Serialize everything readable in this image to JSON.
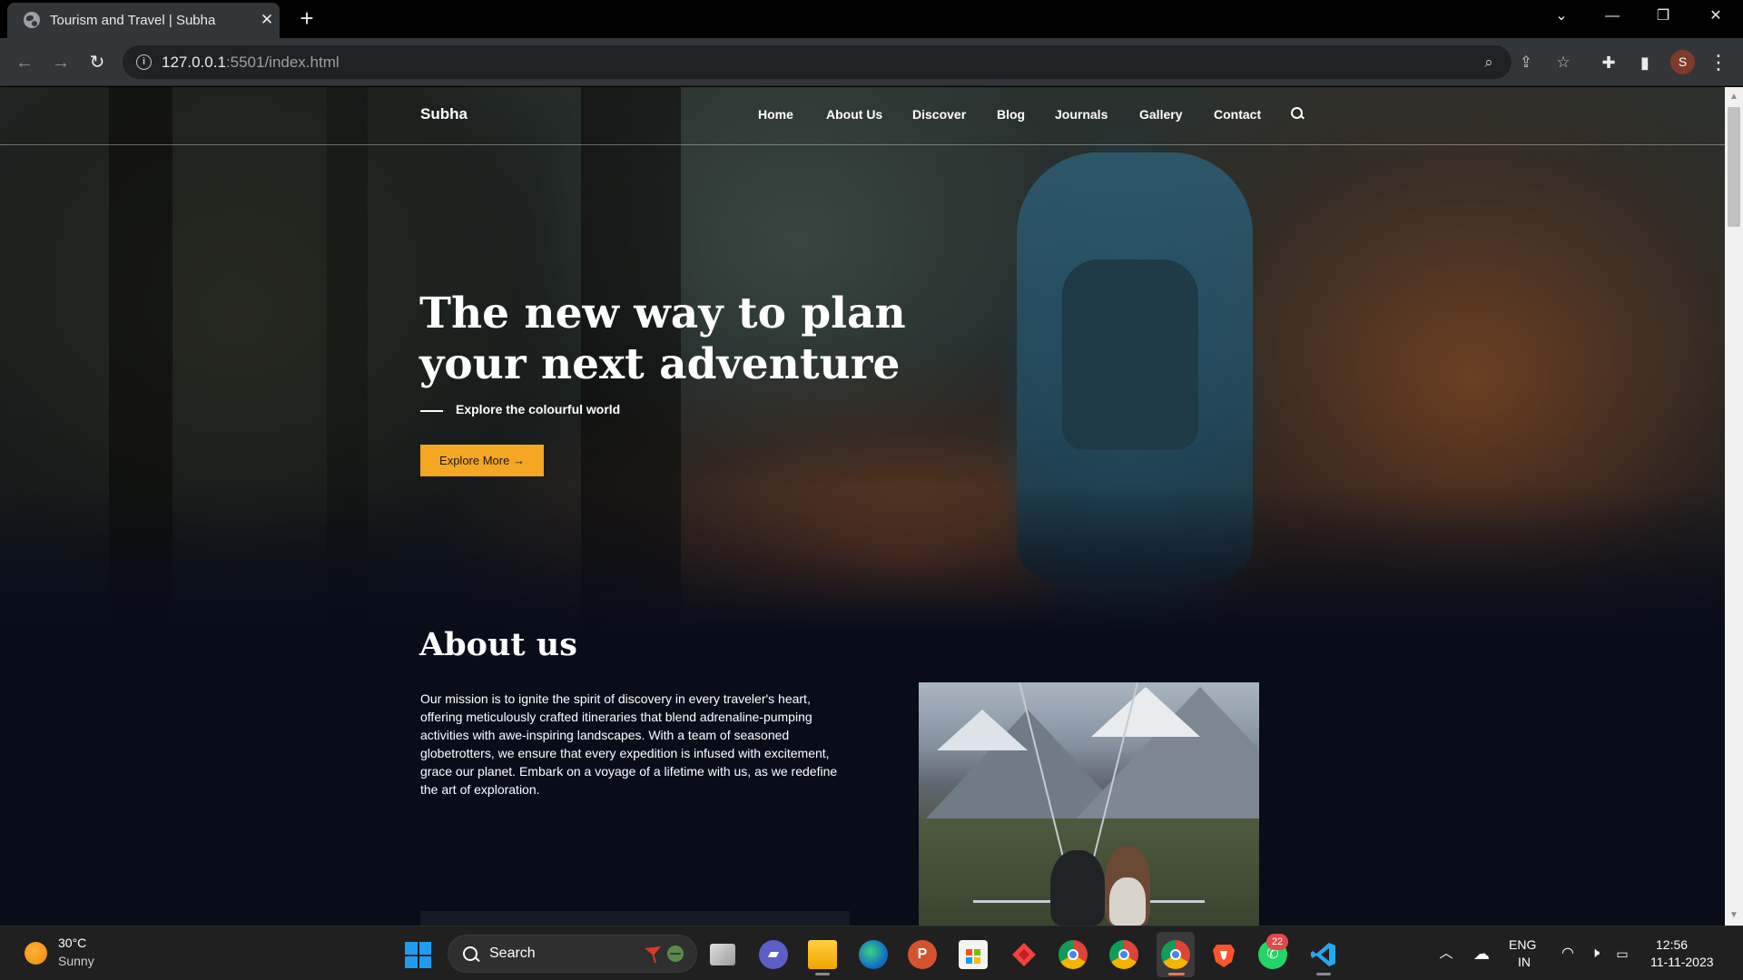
{
  "browser": {
    "tab_title": "Tourism and Travel | Subha",
    "new_tab_label": "+",
    "url_host": "127.0.0.1",
    "url_rest": ":5501/index.html",
    "avatar_letter": "S"
  },
  "site": {
    "brand": "Subha",
    "nav": [
      "Home",
      "About Us",
      "Discover",
      "Blog",
      "Journals",
      "Gallery",
      "Contact"
    ],
    "hero": {
      "title_line1": "The new way to plan",
      "title_line2": "your next adventure",
      "subtitle": "Explore the colourful world",
      "button": "Explore More →"
    },
    "about": {
      "heading": "About us",
      "text": "Our mission is to ignite the spirit of discovery in every traveler's heart, offering meticulously crafted itineraries that blend adrenaline-pumping activities with awe-inspiring landscapes. With a team of seasoned globetrotters, we ensure that every expedition is infused with excitement, grace our planet. Embark on a voyage of a lifetime with us, as we redefine the art of exploration."
    }
  },
  "taskbar": {
    "weather_temp": "30°C",
    "weather_desc": "Sunny",
    "search_label": "Search",
    "whatsapp_badge": "22",
    "lang_top": "ENG",
    "lang_bottom": "IN",
    "time": "12:56",
    "date": "11-11-2023",
    "apps": [
      "task-view",
      "teams-chat",
      "file-explorer",
      "edge",
      "powerpoint",
      "microsoft-store",
      "anydesk",
      "chrome",
      "chrome-profile",
      "chrome-active",
      "brave",
      "whatsapp",
      "vscode"
    ]
  },
  "colors": {
    "accent_button": "#f5a623",
    "page_bg": "#090d1a",
    "chrome_toolbar": "#323639"
  }
}
